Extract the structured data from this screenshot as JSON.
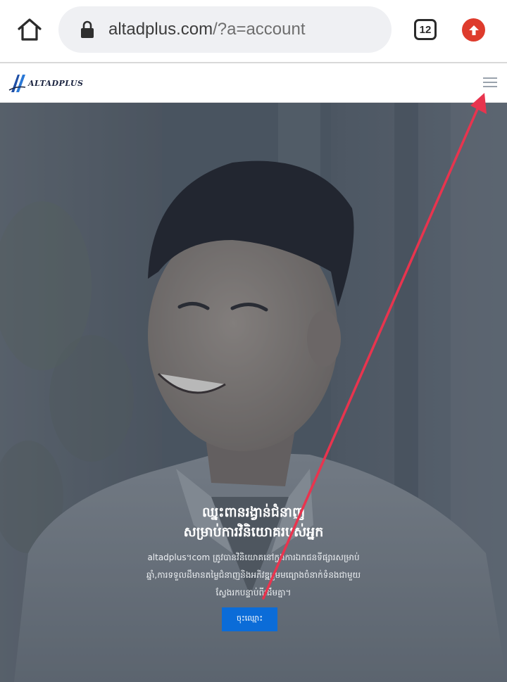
{
  "browser": {
    "url_domain": "altadplus.com",
    "url_path": "/?a=account",
    "tab_count": "12",
    "icons": {
      "home": "home-icon",
      "lock": "lock-icon",
      "tabs": "tab-switcher-icon",
      "update": "update-arrow-icon"
    }
  },
  "site": {
    "logo_text": "ALTADPLUS",
    "menu_icon": "hamburger-menu-icon"
  },
  "hero": {
    "title_line1": "ឈ្នះពានរង្វាន់ជំនាញ",
    "title_line2": "សម្រាប់ការវិនិយោគរបស់អ្នក",
    "desc_line1": "altadplus។com ត្រូវបានវិនិយោគនៅក្នុងការឯកជនទីផ្សារសម្រាប់",
    "desc_line2": "ឆ្នាំ,ការទទួលដឹមានតម្លៃជំនាញនិងអភិវឌ្ឍរួមមធ្យោងចំនាក់ទំនងជាមួយ",
    "desc_line3": "ស្វែងរកបន្ទាប់ពីដើមគ្នា។",
    "cta_label": "ចុះឈ្មោះ"
  },
  "colors": {
    "cta": "#0b6cd8",
    "update_badge": "#de3b2c",
    "annotation_arrow": "#e8344e",
    "url_bar": "#eff0f3"
  }
}
